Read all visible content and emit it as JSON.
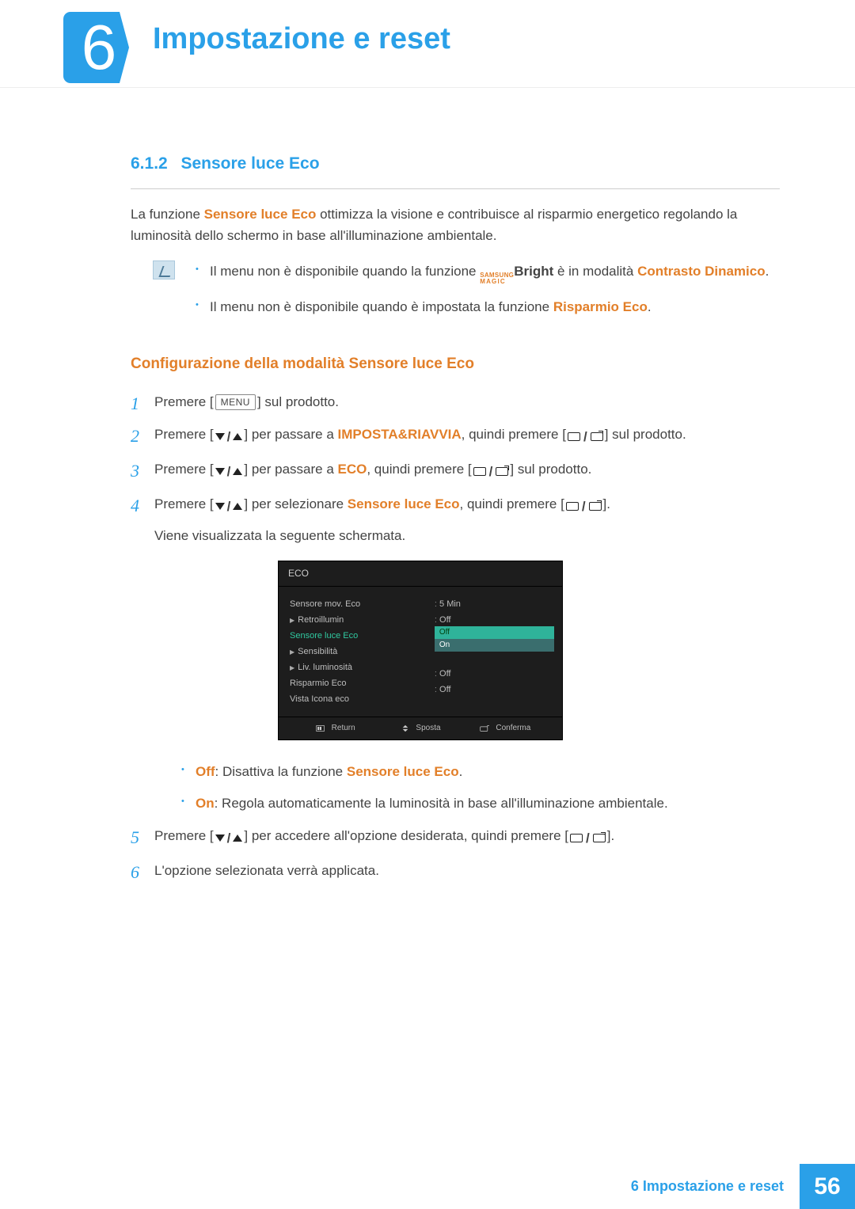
{
  "chapter": {
    "number": "6",
    "title": "Impostazione e reset"
  },
  "section": {
    "number": "6.1.2",
    "title": "Sensore luce Eco"
  },
  "intro": {
    "pre": "La funzione ",
    "kw": "Sensore luce Eco",
    "post": " ottimizza la visione e contribuisce al risparmio energetico regolando la luminosità dello schermo in base all'illuminazione ambientale."
  },
  "notes": {
    "n1": {
      "pre": "Il menu non è disponibile quando la funzione ",
      "magic_top": "SAMSUNG",
      "magic_bot": "MAGIC",
      "bright": "Bright",
      "mid": " è in modalità ",
      "kw": "Contrasto Dinamico",
      "post": "."
    },
    "n2": {
      "pre": "Il menu non è disponibile quando è impostata la funzione ",
      "kw": "Risparmio Eco",
      "post": "."
    }
  },
  "sub_heading": "Configurazione della modalità Sensore luce Eco",
  "labels": {
    "menu_key": "MENU"
  },
  "steps": {
    "s1": {
      "pre": "Premere [",
      "post": "] sul prodotto."
    },
    "s2": {
      "pre": "Premere [",
      "mid1": "] per passare a ",
      "kw": "IMPOSTA&RIAVVIA",
      "mid2": ", quindi premere [",
      "post": "] sul prodotto."
    },
    "s3": {
      "pre": "Premere [",
      "mid1": "] per passare a ",
      "kw": "ECO",
      "mid2": ", quindi premere [",
      "post": "] sul prodotto."
    },
    "s4": {
      "pre": "Premere [",
      "mid1": "] per selezionare ",
      "kw": "Sensore luce Eco",
      "mid2": ", quindi premere [",
      "post": "].",
      "tail": "Viene visualizzata la seguente schermata."
    },
    "s4_off": {
      "kw": "Off",
      "mid": ": Disattiva la funzione ",
      "kw2": "Sensore luce Eco",
      "post": "."
    },
    "s4_on": {
      "kw": "On",
      "post": ": Regola automaticamente la luminosità in base all'illuminazione ambientale."
    },
    "s5": {
      "pre": "Premere [",
      "mid": "] per accedere all'opzione desiderata, quindi premere [",
      "post": "]."
    },
    "s6": {
      "text": "L'opzione selezionata verrà applicata."
    }
  },
  "osd": {
    "title": "ECO",
    "left": {
      "l1": "Sensore mov. Eco",
      "l2": "Retroillumin",
      "l3": "Sensore luce Eco",
      "l4": "Sensibilità",
      "l5": "Liv. luminosità",
      "l6": "Risparmio Eco",
      "l7": "Vista Icona eco"
    },
    "right": {
      "v1": "5 Min",
      "v2": "Off",
      "opt_off": "Off",
      "opt_on": "On",
      "v6": "Off",
      "v7": "Off"
    },
    "foot": {
      "f1": "Return",
      "f2": "Sposta",
      "f3": "Conferma"
    }
  },
  "footer": {
    "label": "6 Impostazione e reset",
    "page": "56"
  }
}
